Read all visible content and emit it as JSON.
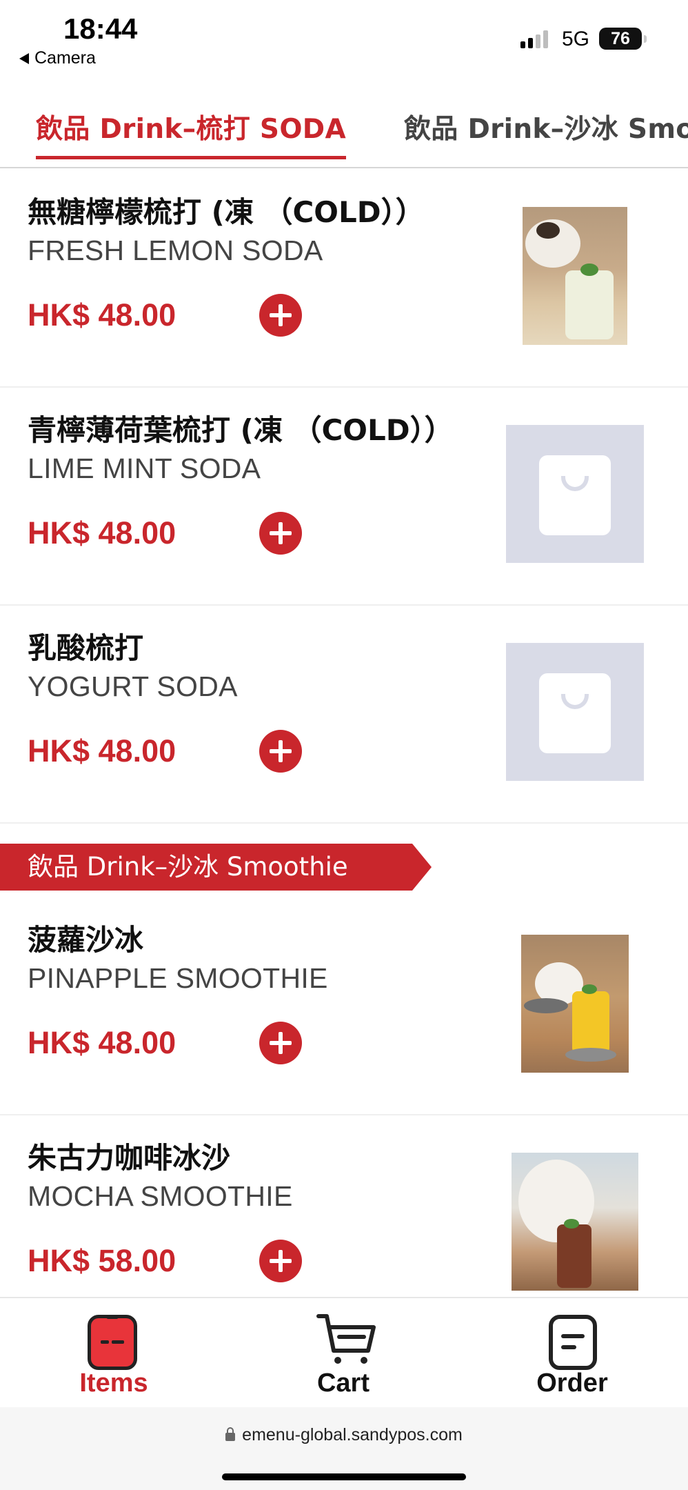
{
  "status_bar": {
    "time": "18:44",
    "back_label": "Camera",
    "network": "5G",
    "battery": "76"
  },
  "tabs": [
    {
      "label": "飲品 Drink–梳打 SODA",
      "active": true
    },
    {
      "label": "飲品 Drink–沙冰 Smoothie",
      "active": false
    }
  ],
  "add_icon": "plus-icon",
  "items": [
    {
      "name_zh": "無糖檸檬梳打 (凍 （COLD））",
      "name_en": "FRESH LEMON SODA",
      "price": "HK$ 48.00",
      "image": "photo"
    },
    {
      "name_zh": "青檸薄荷葉梳打 (凍 （COLD））",
      "name_en": "LIME MINT SODA",
      "price": "HK$ 48.00",
      "image": "placeholder"
    },
    {
      "name_zh": "乳酸梳打",
      "name_en": "YOGURT SODA",
      "price": "HK$ 48.00",
      "image": "placeholder"
    },
    {
      "name_zh": "菠蘿沙冰",
      "name_en": "PINAPPLE SMOOTHIE",
      "price": "HK$ 48.00",
      "image": "photo"
    },
    {
      "name_zh": "朱古力咖啡冰沙",
      "name_en": "MOCHA SMOOTHIE",
      "price": "HK$ 58.00",
      "image": "photo"
    }
  ],
  "section_header": "飲品 Drink–沙冰 Smoothie",
  "bottom_nav": {
    "items_label": "Items",
    "cart_label": "Cart",
    "order_label": "Order",
    "active": "Items"
  },
  "url": "emenu-global.sandypos.com",
  "colors": {
    "accent": "#c9262c",
    "placeholder_bg": "#d9dbe7",
    "text": "#111111",
    "subtext": "#444444"
  }
}
